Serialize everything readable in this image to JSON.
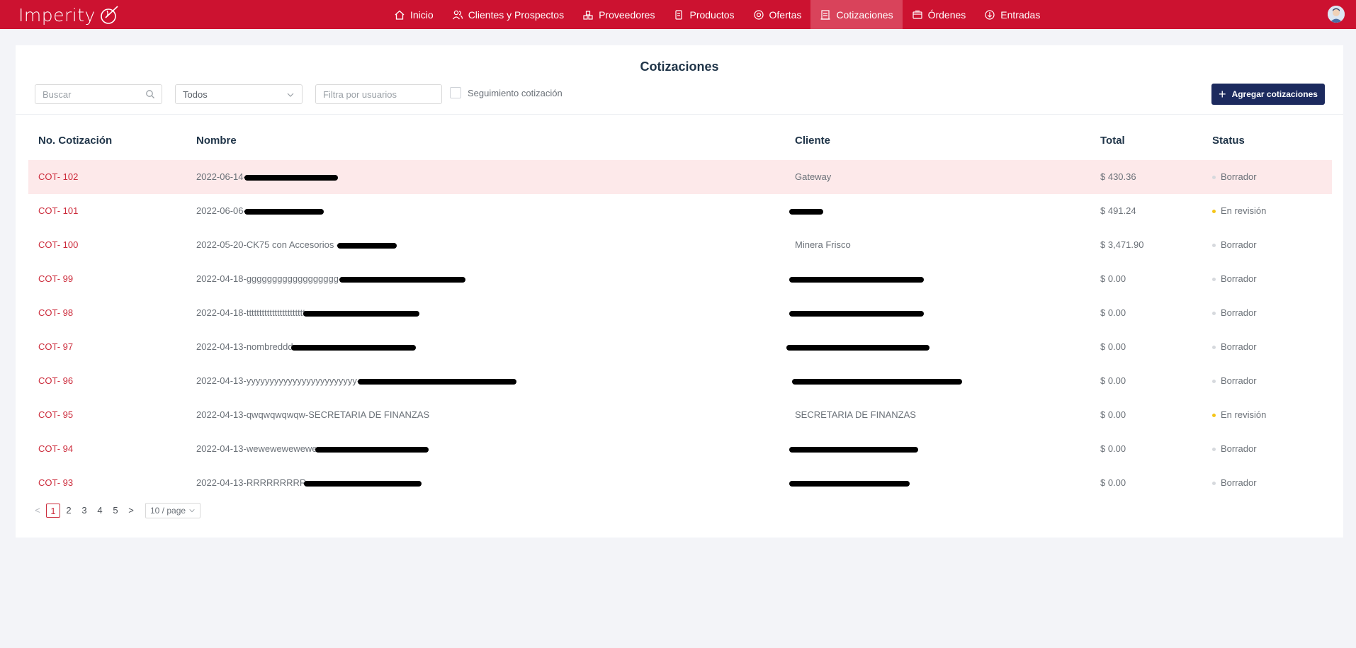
{
  "app": {
    "brand": "Imperity"
  },
  "nav": {
    "items": [
      {
        "label": "Inicio",
        "icon": "home-icon"
      },
      {
        "label": "Clientes y Prospectos",
        "icon": "users-icon"
      },
      {
        "label": "Proveedores",
        "icon": "supplier-icon"
      },
      {
        "label": "Productos",
        "icon": "product-icon"
      },
      {
        "label": "Ofertas",
        "icon": "offer-icon"
      },
      {
        "label": "Cotizaciones",
        "icon": "quote-icon",
        "active": true
      },
      {
        "label": "Órdenes",
        "icon": "orders-icon"
      },
      {
        "label": "Entradas",
        "icon": "inbound-icon"
      }
    ]
  },
  "page": {
    "title": "Cotizaciones",
    "search_placeholder": "Buscar",
    "status_filter_value": "Todos",
    "users_placeholder": "Filtra por usuarios",
    "follow_label": "Seguimiento cotización",
    "add_button_label": "Agregar cotizaciones"
  },
  "table": {
    "headers": [
      "No. Cotización",
      "Nombre",
      "Cliente",
      "Total",
      "Status"
    ],
    "rows": [
      {
        "no": "COT- 102",
        "nombre": "2022-06-14-",
        "cliente": "Gateway",
        "total": "$ 430.36",
        "status": "Borrador"
      },
      {
        "no": "COT- 101",
        "nombre": "2022-06-06-",
        "cliente": "",
        "total": "$ 491.24",
        "status": "En revisión"
      },
      {
        "no": "COT- 100",
        "nombre": "2022-05-20-CK75 con Accesorios -",
        "cliente": "Minera Frisco",
        "total": "$ 3,471.90",
        "status": "Borrador"
      },
      {
        "no": "COT- 99",
        "nombre": "2022-04-18-gggggggggggggggggg-",
        "cliente": "",
        "total": "$ 0.00",
        "status": "Borrador"
      },
      {
        "no": "COT- 98",
        "nombre": "2022-04-18-ttttttttttttttttttttttt",
        "cliente": "",
        "total": "$ 0.00",
        "status": "Borrador"
      },
      {
        "no": "COT- 97",
        "nombre": "2022-04-13-nombreddd",
        "cliente": "",
        "total": "$ 0.00",
        "status": "Borrador"
      },
      {
        "no": "COT- 96",
        "nombre": "2022-04-13-yyyyyyyyyyyyyyyyyyyyyyyy-",
        "cliente": "",
        "total": "$ 0.00",
        "status": "Borrador"
      },
      {
        "no": "COT- 95",
        "nombre": "2022-04-13-qwqwqwqwqw-SECRETARIA DE FINANZAS",
        "cliente": "SECRETARIA DE FINANZAS",
        "total": "$ 0.00",
        "status": "En revisión"
      },
      {
        "no": "COT- 94",
        "nombre": "2022-04-13-wewewewewewe",
        "cliente": "",
        "total": "$ 0.00",
        "status": "Borrador"
      },
      {
        "no": "COT- 93",
        "nombre": "2022-04-13-RRRRRRRRR",
        "cliente": "",
        "total": "$ 0.00",
        "status": "Borrador"
      }
    ]
  },
  "status_colors": {
    "Borrador": "#d6d9dd",
    "En revisión": "#f5c518"
  },
  "pagination": {
    "pages": [
      "1",
      "2",
      "3",
      "4",
      "5"
    ],
    "current": "1",
    "page_size": "10 / page",
    "prev": "<",
    "next": ">"
  }
}
